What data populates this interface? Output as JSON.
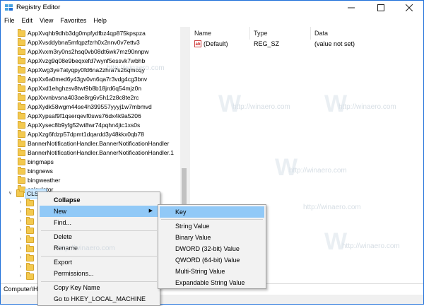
{
  "window": {
    "title": "Registry Editor"
  },
  "menu": [
    "File",
    "Edit",
    "View",
    "Favorites",
    "Help"
  ],
  "tree": {
    "items": [
      "AppXvqhb9dhb3dg0mpfydfbz4qp875kpspza",
      "AppXvsddybna5mfqpzfzrh0x2nnv0v7ettv3",
      "AppXvxm3ry0ns2hsq0vb08dt6wk7mz90nnpw",
      "AppXvzg9q08e9beqxefd7wynf5essvk7wbhb",
      "AppXwg3ye7atyqpy0fd6na2zhra7s26qmcqy",
      "AppXx6a0med6y43gv0vn6qa7r3vdg4cg3bnv",
      "AppXxd1ehghzsv8twt9b8b18jrd6q54mjz0n",
      "AppXxvnbvsna403ae8rg6v5h12z8c8te2rc",
      "AppXydk58wgm44se4h399557yyyj1w7mbmvd",
      "AppXypsaf9f1qserqevf0sws76dx4k9a5206",
      "AppXysec8b9yfg52wt8wr74pqhn4jtc1xs0s",
      "AppXzg6fdzp57dpmt1dqardd3y48kkx0qb78",
      "BannerNotificationHandler.BannerNotificationHandler",
      "BannerNotificationHandler.BannerNotificationHandler.1",
      "bingmaps",
      "bingnews",
      "bingweather",
      "calculator"
    ],
    "selected": "CLSID"
  },
  "values_pane": {
    "columns": [
      "Name",
      "Type",
      "Data"
    ],
    "rows": [
      {
        "name": "(Default)",
        "type": "REG_SZ",
        "data": "(value not set)",
        "icon": "string-value-icon"
      }
    ]
  },
  "watermark": [
    "http://winaero.com",
    "http://winaero.com",
    "http://winaero.com",
    "http://winaero.com",
    "http://winaero.com",
    "http://winaero.com",
    "http://winaero.com"
  ],
  "status": {
    "path_prefix": "Computer\\H"
  },
  "context_menu": {
    "items": [
      "Collapse",
      "New",
      "Find...",
      "Delete",
      "Rename",
      "Export",
      "Permissions...",
      "Copy Key Name",
      "Go to HKEY_LOCAL_MACHINE"
    ]
  },
  "submenu": {
    "items": [
      "Key",
      "String Value",
      "Binary Value",
      "DWORD (32-bit) Value",
      "QWORD (64-bit) Value",
      "Multi-String Value",
      "Expandable String Value"
    ]
  },
  "colors": {
    "highlight": "#91c9f7",
    "selection": "#cce8ff",
    "folder": "#f3c94f"
  }
}
